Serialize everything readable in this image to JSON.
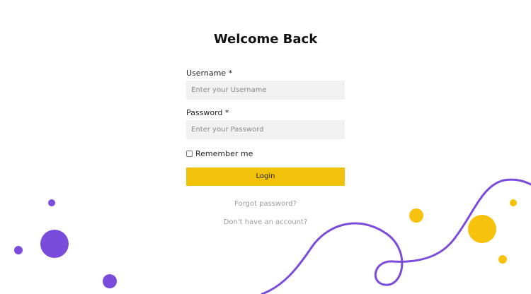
{
  "page": {
    "title": "Welcome Back"
  },
  "form": {
    "username_label": "Username *",
    "username_placeholder": "Enter your Username",
    "username_value": "",
    "password_label": "Password *",
    "password_placeholder": "Enter your Password",
    "password_value": "",
    "remember_label": "Remember me",
    "remember_checked": false,
    "login_label": "Login"
  },
  "links": {
    "forgot": "Forgot password?",
    "signup": "Don't have an account?"
  },
  "colors": {
    "accent_yellow": "#f1c10b",
    "decor_purple": "#7b4bdc",
    "input_bg": "#f1f1f1",
    "link_gray": "#9a9a9a"
  }
}
